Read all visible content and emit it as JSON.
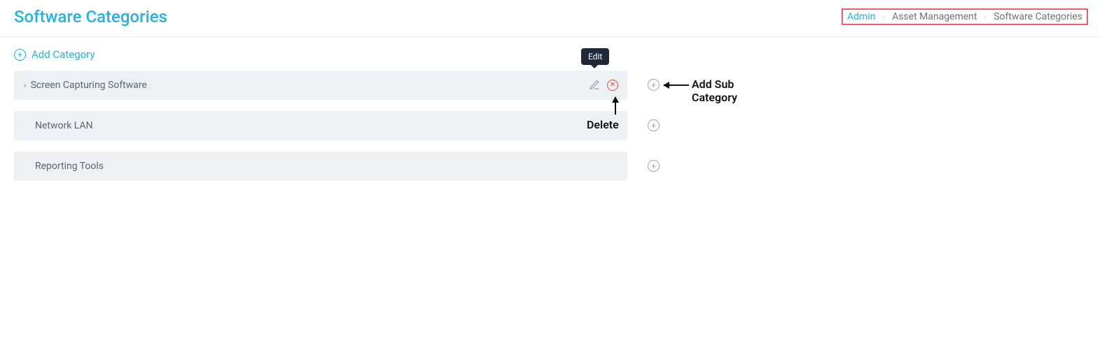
{
  "header": {
    "title": "Software Categories"
  },
  "breadcrumb": {
    "admin": "Admin",
    "asset_mgmt": "Asset Management",
    "current": "Software Categories"
  },
  "actions": {
    "add_category": "Add Category"
  },
  "tooltip": {
    "edit": "Edit"
  },
  "annotations": {
    "add_sub": "Add Sub Category",
    "delete": "Delete"
  },
  "categories": [
    {
      "name": "Screen Capturing Software",
      "expandable": true,
      "show_actions": true
    },
    {
      "name": "Network LAN",
      "expandable": false,
      "show_actions": false
    },
    {
      "name": "Reporting Tools",
      "expandable": false,
      "show_actions": false
    }
  ]
}
